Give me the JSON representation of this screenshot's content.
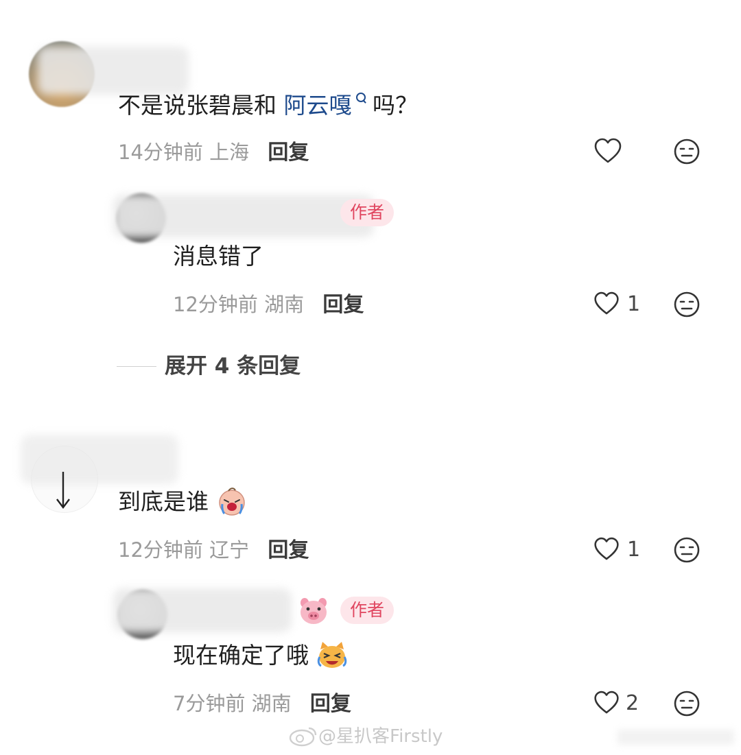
{
  "comments": [
    {
      "text_plain": "不是说张碧晨和 ",
      "link_text": "阿云嘎",
      "text_after": " 吗？",
      "time": "14分钟前",
      "location": "上海",
      "reply_label": "回复",
      "likes": "",
      "replies": [
        {
          "author_tag": "作者",
          "text": "消息错了",
          "time": "12分钟前",
          "location": "湖南",
          "reply_label": "回复",
          "likes": "1"
        }
      ],
      "expand_label": "展开 4 条回复"
    },
    {
      "text_plain": "到底是谁",
      "time": "12分钟前",
      "location": "辽宁",
      "reply_label": "回复",
      "likes": "1",
      "replies": [
        {
          "author_tag": "作者",
          "text": "现在确定了哦",
          "time": "7分钟前",
          "location": "湖南",
          "reply_label": "回复",
          "likes": "2"
        }
      ]
    }
  ],
  "watermark": "@星扒客Firstly",
  "colors": {
    "link": "#1d4a8c",
    "author_tag_bg": "#fde6ea",
    "author_tag_text": "#e0455f",
    "meta_text": "#9a9a9a"
  },
  "icons": [
    "heart-outline-icon",
    "neutral-face-icon",
    "crying-baby-emoji",
    "pig-face-emoji",
    "crying-laughing-cat-emoji",
    "down-arrow-icon",
    "weibo-logo-icon"
  ]
}
